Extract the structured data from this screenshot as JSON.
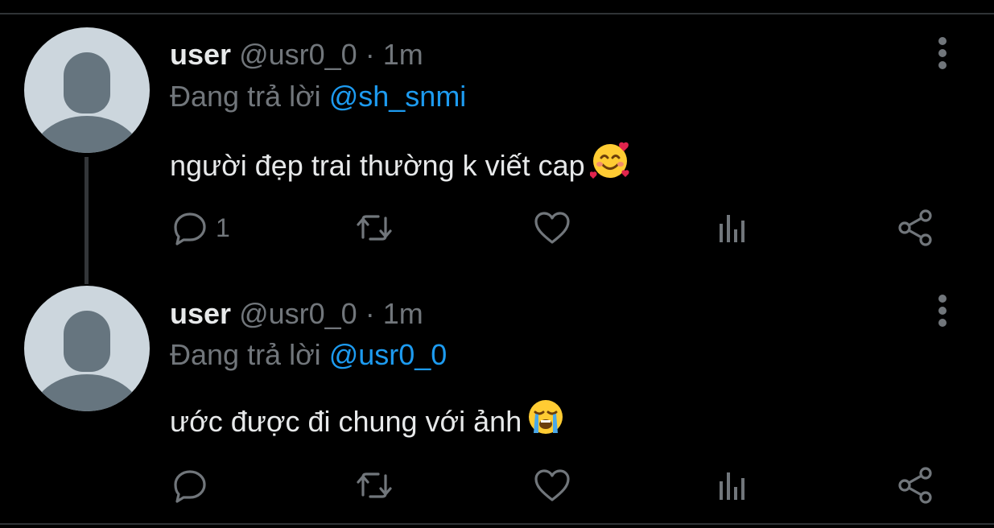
{
  "tweets": [
    {
      "name": "user",
      "handle": "@usr0_0",
      "separator": "·",
      "time": "1m",
      "reply_prefix": "Đang trả lời",
      "reply_to": "@sh_snmi",
      "text": "người đẹp trai thường k viết cap",
      "emoji": "smiling-face-with-hearts-icon",
      "reply_count": "1"
    },
    {
      "name": "user",
      "handle": "@usr0_0",
      "separator": "·",
      "time": "1m",
      "reply_prefix": "Đang trả lời",
      "reply_to": "@usr0_0",
      "text": "ước được đi chung với ảnh",
      "emoji": "loudly-crying-face-icon",
      "reply_count": ""
    }
  ],
  "colors": {
    "background": "#000000",
    "text": "#e7e9ea",
    "muted": "#71767b",
    "accent": "#1d9bf0",
    "avatar_bg": "#ccd6dd",
    "avatar_fg": "#66757f"
  },
  "icons": [
    "more-vertical-icon",
    "reply-icon",
    "retweet-icon",
    "like-icon",
    "analytics-icon",
    "share-icon"
  ]
}
